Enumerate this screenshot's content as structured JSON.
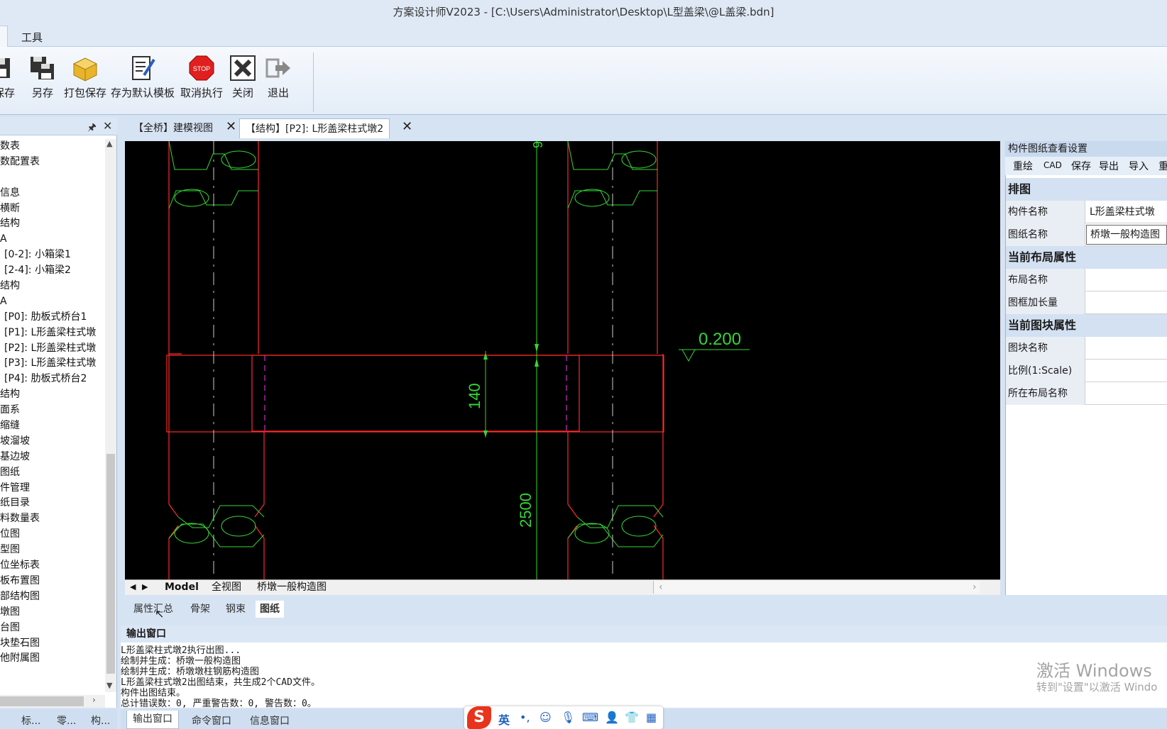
{
  "window": {
    "title": "方案设计师V2023 - [C:\\Users\\Administrator\\Desktop\\L型盖梁\\@L盖梁.bdn]"
  },
  "ribbon": {
    "tab_tools": "工具",
    "buttons": [
      {
        "name": "save",
        "label": "保存",
        "icon": "floppy-icon"
      },
      {
        "name": "save-as",
        "label": "另存",
        "icon": "floppy-save-as-icon"
      },
      {
        "name": "pack-save",
        "label": "打包保存",
        "icon": "package-icon"
      },
      {
        "name": "save-template",
        "label": "存为默认模板",
        "icon": "document-edit-icon"
      },
      {
        "name": "cancel-exec",
        "label": "取消执行",
        "icon": "stop-sign-icon"
      },
      {
        "name": "close",
        "label": "关闭",
        "icon": "close-x-icon"
      },
      {
        "name": "exit",
        "label": "退出",
        "icon": "exit-arrow-icon"
      }
    ]
  },
  "tree": {
    "items": [
      "数表",
      "数配置表",
      "",
      "信息",
      "横断",
      "结构",
      "A",
      "[0-2]:  小箱梁1",
      "[2-4]:  小箱梁2",
      "结构",
      "A",
      "[P0]:  肋板式桥台1",
      "[P1]:  L形盖梁柱式墩",
      "[P2]:  L形盖梁柱式墩",
      "[P3]:  L形盖梁柱式墩",
      "[P4]:  肋板式桥台2",
      "结构",
      "面系",
      "缩缝",
      "坡溜坡",
      "基边坡",
      "图纸",
      "件管理",
      "纸目录",
      "料数量表",
      "位图",
      "型图",
      "位坐标表",
      "板布置图",
      "部结构图",
      "墩图",
      "台图",
      "块垫石图",
      "他附属图"
    ],
    "bottom_tabs": [
      "标...",
      "零...",
      "构..."
    ]
  },
  "doc_tabs": [
    {
      "label": "【全桥】建模视图"
    },
    {
      "label": "【结构】[P2]:  L形盖梁柱式墩2"
    }
  ],
  "drawing": {
    "dim_top": "9",
    "dim_140": "140",
    "dim_2500": "2500",
    "elevation": "0.200"
  },
  "layout_tabs": [
    "Model",
    "全视图",
    "桥墩一般构造图"
  ],
  "property_panel": {
    "title": "构件图纸查看设置",
    "toolbar": [
      "重绘",
      "CAD",
      "保存",
      "导出",
      "导入",
      "重"
    ],
    "groups": [
      {
        "title": "排图",
        "rows": [
          {
            "key": "构件名称",
            "value": "L形盖梁柱式墩"
          },
          {
            "key": "图纸名称",
            "value": "桥墩一般构造图"
          }
        ]
      },
      {
        "title": "当前布局属性",
        "rows": [
          {
            "key": "布局名称",
            "value": ""
          },
          {
            "key": "图框加长量(mm)",
            "value": ""
          }
        ]
      },
      {
        "title": "当前图块属性",
        "rows": [
          {
            "key": "图块名称",
            "value": ""
          },
          {
            "key": "比例(1:Scale)",
            "value": ""
          },
          {
            "key": "所在布局名称",
            "value": ""
          }
        ]
      }
    ]
  },
  "mini_tabs": [
    "属性汇总",
    "骨架",
    "钢束",
    "图纸"
  ],
  "output": {
    "title": "输出窗口",
    "lines": [
      "    L形盖梁柱式墩2执行出图...",
      "    绘制并生成：桥墩一般构造图",
      "    绘制并生成：桥墩墩柱钢筋构造图",
      "    L形盖梁柱式墩2出图结束，共生成2个CAD文件。",
      "构件出图结束。",
      "总计错误数：0, 严重警告数：0, 警告数：0。"
    ]
  },
  "bottom_tabs": [
    "输出窗口",
    "命令窗口",
    "信息窗口"
  ],
  "watermark": {
    "line1": "激活 Windows",
    "line2": "转到\"设置\"以激活 Windo"
  },
  "ime": {
    "logo": "S",
    "lang": "英",
    "icons": [
      "punct-icon",
      "emoji-icon",
      "mic-icon",
      "keyboard-icon",
      "user-icon",
      "skin-icon",
      "grid-icon"
    ]
  },
  "colors": {
    "canvas_bg": "#000000",
    "red": "#ff2a2a",
    "green": "#35d635",
    "magenta": "#d02ad0"
  }
}
